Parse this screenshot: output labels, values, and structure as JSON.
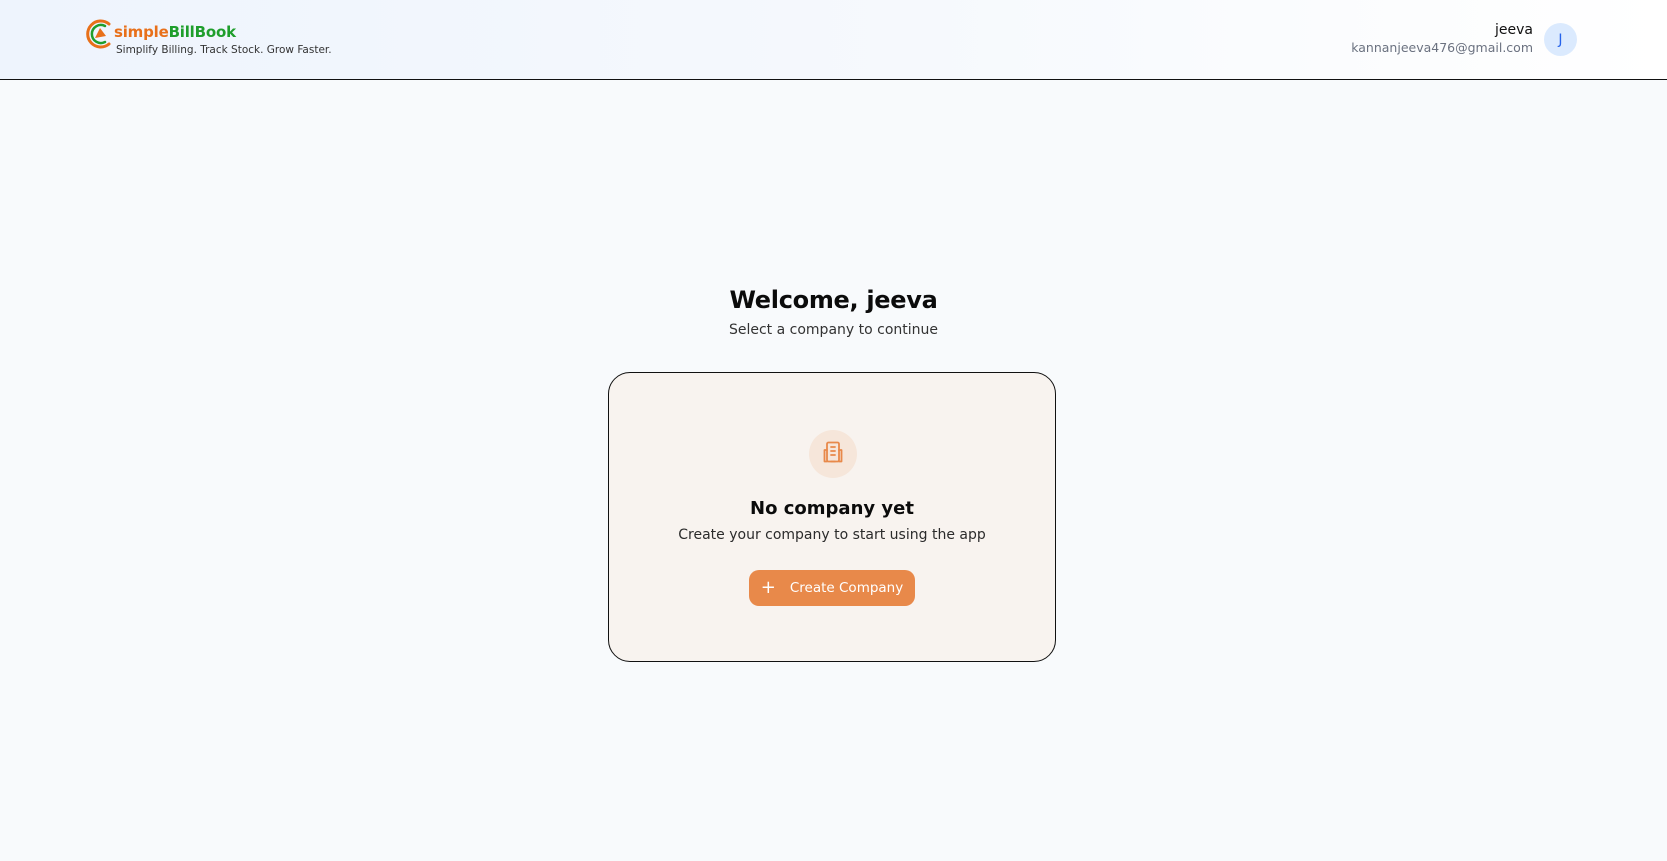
{
  "header": {
    "brand": {
      "logo_icon": "simplebillbook-logo-icon",
      "name_part1": "simple",
      "name_part2": "BillBook",
      "tagline": "Simplify Billing. Track Stock. Grow Faster."
    },
    "user": {
      "name": "jeeva",
      "email": "kannanjeeva476@gmail.com",
      "avatar_initial": "J"
    }
  },
  "main": {
    "title": "Welcome, jeeva",
    "subtitle": "Select a company to continue",
    "empty_state": {
      "icon": "building-icon",
      "title": "No company yet",
      "description": "Create your company to start using the app",
      "button": {
        "icon": "plus-icon",
        "label": "Create Company"
      }
    }
  },
  "colors": {
    "accent": "#e8894a",
    "brand_orange": "#e8701a",
    "brand_green": "#1f9e2c",
    "avatar_bg": "#dbeafe",
    "avatar_text": "#2563eb",
    "card_bg": "#f8f3ef"
  }
}
